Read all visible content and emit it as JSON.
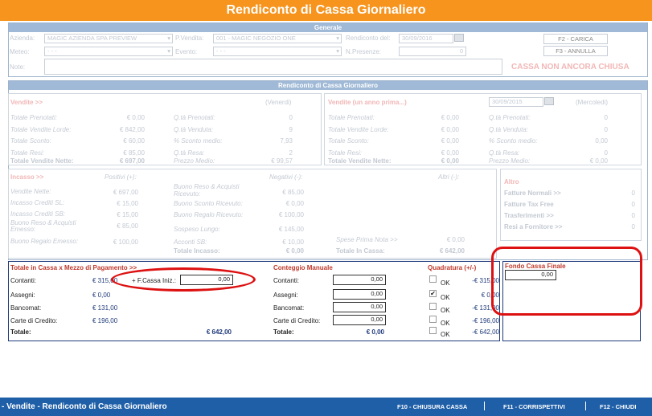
{
  "title": "Rendiconto di Cassa Giornaliero",
  "generale": {
    "header": "Generale",
    "azienda_label": "Azienda:",
    "azienda_value": "MAGIC AZIENDA SPA PREVIEW",
    "pvendita_label": "P.Vendita:",
    "pvendita_value": "001 - MAGIC NEGOZIO ONE",
    "rendiconto_label": "Rendiconto del:",
    "rendiconto_value": "30/09/2016",
    "meteo_label": "Meteo:",
    "meteo_value": "- - -",
    "evento_label": "Evento:",
    "evento_value": "- - -",
    "npresenze_label": "N.Presenze:",
    "npresenze_value": "0",
    "note_label": "Note:",
    "f2_button": "F2 - CARICA",
    "f3_button": "F3 - ANNULLA",
    "status": "CASSA NON ANCORA CHIUSA"
  },
  "rendiconto": {
    "header": "Rendiconto di Cassa Giornaliero",
    "vendite": {
      "title": "Vendite >>",
      "day": "(Venerdi)",
      "rows": [
        [
          "Totale Prenotati:",
          "€ 0,00",
          "Q.tà Prenotati:",
          "0"
        ],
        [
          "Totale Vendite Lorde:",
          "€ 842,00",
          "Q.tà Venduta:",
          "9"
        ],
        [
          "Totale Sconto:",
          "€ 60,00",
          "% Sconto medio:",
          "7,93"
        ],
        [
          "Totale Resi:",
          "€ 85,00",
          "Q.tà Resa:",
          "2"
        ]
      ],
      "nette_label": "Totale Vendite Nette:",
      "nette_value": "€ 697,00",
      "prezzo_label": "Prezzo Medio:",
      "prezzo_value": "€ 99,57"
    },
    "vendite_prev": {
      "title": "Vendite (un anno prima...)",
      "date": "30/09/2015",
      "day": "(Mercoledi)",
      "rows": [
        [
          "Totale Prenotati:",
          "€ 0,00",
          "Q.tà Prenotati:",
          "0"
        ],
        [
          "Totale Vendite Lorde:",
          "€ 0,00",
          "Q.tà Venduta:",
          "0"
        ],
        [
          "Totale Sconto:",
          "€ 0,00",
          "% Sconto medio:",
          "0,00"
        ],
        [
          "Totale Resi:",
          "€ 0,00",
          "Q.tà Resa:",
          "0"
        ]
      ],
      "nette_label": "Totale Vendite Nette:",
      "nette_value": "€ 0,00",
      "prezzo_label": "Prezzo Medio:",
      "prezzo_value": "€ 0,00"
    },
    "incasso": {
      "title": "Incasso >>",
      "positivi": "Positivi (+):",
      "negativi": "Negativi (-):",
      "altri": "Altri (-):",
      "c1": [
        [
          "Vendite Nette:",
          "€ 697,00"
        ],
        [
          "Incasso Crediti SL:",
          "€ 15,00"
        ],
        [
          "Incasso Crediti SB:",
          "€ 15,00"
        ],
        [
          "Buono Reso & Acquisti Emesso:",
          "€ 85,00"
        ],
        [
          "Buono Regalo Emesso:",
          "€ 100,00"
        ]
      ],
      "c2": [
        [
          "Buono Reso & Acquisti Ricevuto:",
          "€ 85,00"
        ],
        [
          "Buono Sconto Ricevuto:",
          "€ 0,00"
        ],
        [
          "Buono Regalo Ricevuto:",
          "€ 100,00"
        ],
        [
          "Sospeso Lungo:",
          "€ 145,00"
        ],
        [
          "Acconti SB:",
          "€ 10,00"
        ]
      ],
      "spese_label": "Spese Prima Nota >>",
      "spese_value": "€ 0,00",
      "tot_incasso_label": "Totale Incasso:",
      "tot_incasso_value": "€ 0,00",
      "tot_cassa_label": "Totale In Cassa:",
      "tot_cassa_value": "€ 642,00"
    },
    "altro": {
      "title": "Altro",
      "items": [
        [
          "Fatture Normali >>",
          "0"
        ],
        [
          "Fatture Tax Free",
          "0"
        ],
        [
          "Trasferimenti >>",
          "0"
        ],
        [
          "Resi a Fornitore >>",
          "0"
        ]
      ]
    }
  },
  "totale": {
    "title": "Totale in Cassa x Mezzo di Pagamento >>",
    "rows": [
      [
        "Contanti:",
        "€ 315,00"
      ],
      [
        "Assegni:",
        "€ 0,00"
      ],
      [
        "Bancomat:",
        "€ 131,00"
      ],
      [
        "Carte di Credito:",
        "€ 196,00"
      ]
    ],
    "totale_label": "Totale:",
    "totale_value": "€ 642,00",
    "fcassa_label": "+ F.Cassa Iniz.:",
    "fcassa_value": "0,00"
  },
  "conteggio": {
    "title": "Conteggio Manuale",
    "labels": [
      "Contanti:",
      "Assegni:",
      "Bancomat:",
      "Carte di Credito:"
    ],
    "values": [
      "0,00",
      "0,00",
      "0,00",
      "0,00"
    ],
    "totale_label": "Totale:",
    "totale_value": "€ 0,00"
  },
  "quadratura": {
    "title": "Quadratura (+/-)",
    "ok_label": "OK",
    "checked": [
      false,
      true,
      false,
      false,
      false
    ],
    "values": [
      "-€ 315,00",
      "€ 0,00",
      "-€ 131,00",
      "-€ 196,00",
      "-€ 642,00"
    ]
  },
  "fondo": {
    "title": "Fondo Cassa Finale",
    "value": "0,00"
  },
  "footer": {
    "left": "- Vendite - Rendiconto di Cassa Giornaliero",
    "f10": "F10 - CHIUSURA CASSA",
    "f11": "F11 - CORRISPETTIVI",
    "f12": "F12 - CHIUDI"
  }
}
